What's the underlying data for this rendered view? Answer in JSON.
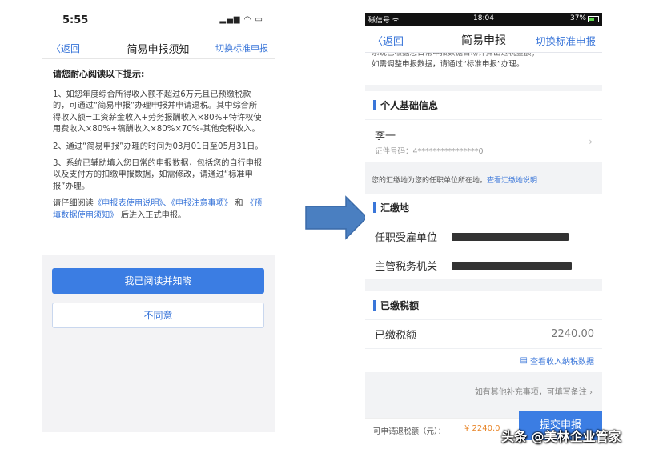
{
  "left": {
    "status_time": "5:55",
    "nav": {
      "back": "〈返回",
      "title": "简易申报须知",
      "right": "切换标准申报"
    },
    "heading": "请您耐心阅读以下提示:",
    "p1": "1、如您年度综合所得收入额不超过6万元且已预缴税款的，可通过“简易申报”办理申报并申请退税。其中综合所得收入额=工资薪金收入+劳务报酬收入×80%+特许权使用费收入×80%+稿酬收入×80%×70%-其他免税收入。",
    "p2": "2、通过“简易申报”办理的时间为03月01日至05月31日。",
    "p3": "3、系统已辅助填入您日常的申报数据，包括您的自行申报以及支付方的扣缴申报数据，如需修改，请通过“标准申报”办理。",
    "p4_a": "请仔细阅读",
    "p4_link1": "《申报表使用说明》、《申报注意事项》",
    "p4_b": "和",
    "p4_link2": "《预填数据使用须知》",
    "p4_c": "后进入正式申报。",
    "agree_button": "我已阅读并知晓",
    "disagree_button": "不同意"
  },
  "right": {
    "status": {
      "left": "磁信号 ᯤ",
      "time": "18:04",
      "battery": "37%"
    },
    "nav": {
      "back": "〈返回",
      "title": "简易申报",
      "right": "切换标准申报"
    },
    "notice_cut": "系统已根据您日常申报数据自动计算出退税金额；",
    "notice": "如需调整申报数据，请通过“标准申报”办理。",
    "basic_header": "个人基础信息",
    "person_name": "李一",
    "id_label": "证件号码：4****************0",
    "location_note": "您的汇缴地为您的任职单位所在地。",
    "location_link": "查看汇缴地说明",
    "huijiao_header": "汇缴地",
    "employer_label": "任职受雇单位",
    "tax_office_label": "主管税务机关",
    "paid_header": "已缴税额",
    "paid_label": "已缴税额",
    "paid_value": "2240.00",
    "view_income": "查看收入纳税数据",
    "remark": "如有其他补充事项，可填写备注",
    "refund_label": "可申请退税额（元）：",
    "refund_value": "¥ 2240.0",
    "submit": "提交申报"
  },
  "watermark": "头条 @美林企业管家"
}
